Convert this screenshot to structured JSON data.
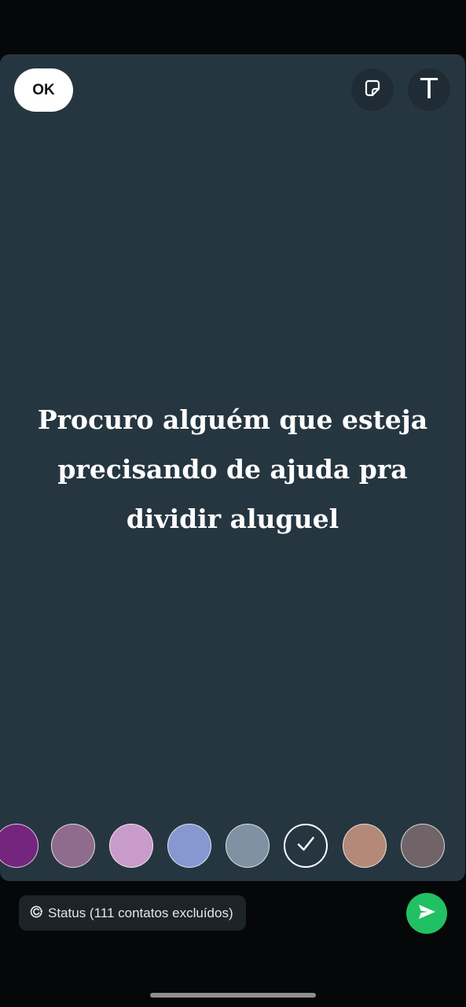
{
  "toolbar": {
    "ok_label": "OK",
    "sticker_icon": "sticker-icon",
    "text_icon": "text-tool-icon",
    "text_glyph": "T"
  },
  "status": {
    "text": "Procuro alguém que esteja precisando de ajuda pra dividir aluguel",
    "background_color": "#263641"
  },
  "palette": {
    "colors": [
      "#74267f",
      "#8f6b8e",
      "#c99bca",
      "#8797cf",
      "#7f91a2",
      "#263641",
      "#b48977",
      "#716468"
    ],
    "selected_index": 5,
    "selected_icon": "check-icon"
  },
  "footer": {
    "audience_label": "Status (111 contatos excluídos)",
    "audience_icon": "status-icon",
    "send_icon": "send-icon",
    "accent": "#21c063"
  }
}
